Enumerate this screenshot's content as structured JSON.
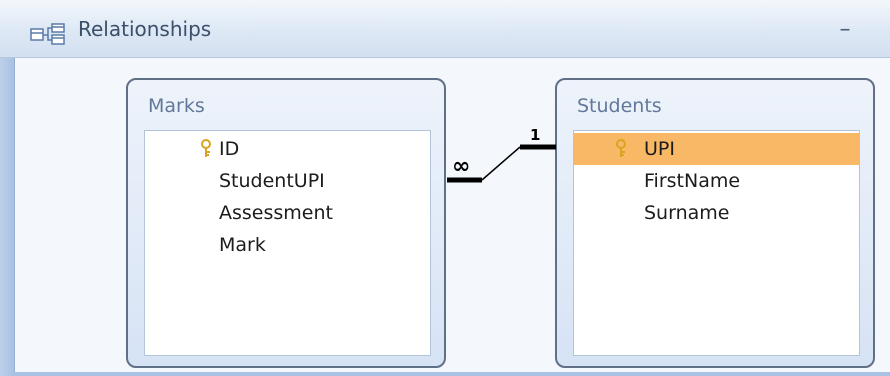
{
  "window": {
    "title": "Relationships",
    "icon": "relationships-icon",
    "minimize_glyph": "–"
  },
  "tables": [
    {
      "name": "Marks",
      "fields": [
        {
          "label": "ID",
          "primary_key": true
        },
        {
          "label": "StudentUPI",
          "primary_key": false
        },
        {
          "label": "Assessment",
          "primary_key": false
        },
        {
          "label": "Mark",
          "primary_key": false
        }
      ]
    },
    {
      "name": "Students",
      "fields": [
        {
          "label": "UPI",
          "primary_key": true,
          "selected": true
        },
        {
          "label": "FirstName",
          "primary_key": false
        },
        {
          "label": "Surname",
          "primary_key": false
        }
      ]
    }
  ],
  "relationship": {
    "from_table": "Students",
    "from_field": "UPI",
    "to_table": "Marks",
    "to_field": "StudentUPI",
    "one_side_label": "1",
    "many_side_label": "∞"
  },
  "colors": {
    "selected_row": "#f9b866",
    "table_border": "#5f7087",
    "header_text": "#62789a",
    "key_icon": "#d9a520"
  }
}
